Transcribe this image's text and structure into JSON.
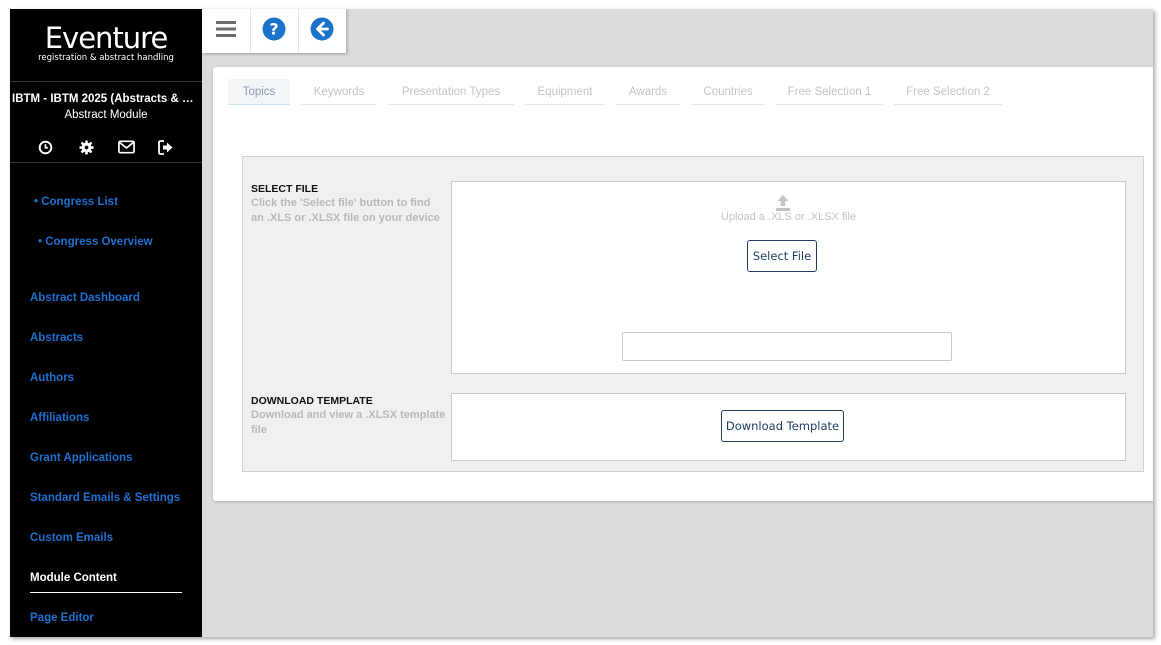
{
  "sidebar": {
    "logo_title": "Eventure",
    "logo_subtitle": "registration & abstract handling",
    "project_name": "IBTM - IBTM 2025 (Abstracts & Par...",
    "module_name": "Abstract Module",
    "tools": [
      "clock-icon",
      "gear-icon",
      "envelope-icon",
      "sign-out-icon"
    ],
    "sub_items": [
      "• Congress List",
      "• Congress Overview"
    ],
    "items": [
      {
        "label": "Abstract Dashboard"
      },
      {
        "label": "Abstracts"
      },
      {
        "label": "Authors"
      },
      {
        "label": "Affiliations"
      },
      {
        "label": "Grant Applications"
      },
      {
        "label": "Standard Emails & Settings"
      },
      {
        "label": "Custom Emails"
      },
      {
        "label": "Module Content",
        "active": true
      },
      {
        "label": "Page Editor"
      }
    ]
  },
  "toolbar": {
    "icons": [
      "hamburger-menu-icon",
      "help-icon",
      "back-arrow-icon"
    ]
  },
  "tabs": [
    {
      "label": "Topics",
      "active": true
    },
    {
      "label": "Keywords"
    },
    {
      "label": "Presentation Types"
    },
    {
      "label": "Equipment"
    },
    {
      "label": "Awards"
    },
    {
      "label": "Countries"
    },
    {
      "label": "Free Selection 1"
    },
    {
      "label": "Free Selection 2"
    }
  ],
  "select_file": {
    "title": "SELECT FILE",
    "description": "Click the 'Select file' button to find an .XLS or .XLSX file on your device",
    "upload_hint": "Upload a .XLS or .XLSX file",
    "button_label": "Select File",
    "file_value": ""
  },
  "download_template": {
    "title": "DOWNLOAD TEMPLATE",
    "description": "Download and view a .XLSX template file",
    "button_label": "Download Template"
  },
  "colors": {
    "sidebar_bg": "#000000",
    "nav_link": "#1f6fd1",
    "button_border": "#1d3f66",
    "toolbar_icon_blue": "#1a73c8",
    "toolbar_icon_gray": "#6b6b6b"
  }
}
